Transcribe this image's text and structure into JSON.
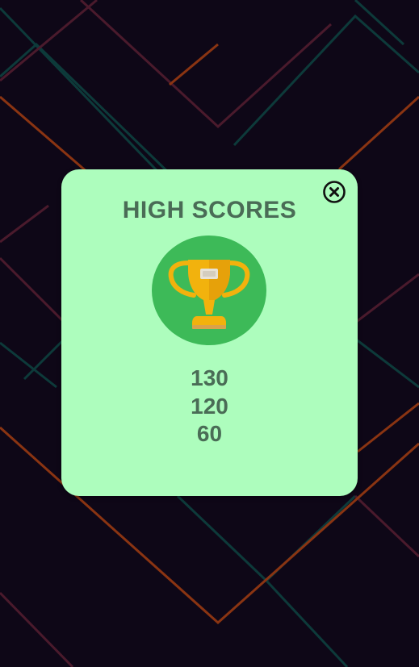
{
  "dialog": {
    "title": "HIGH SCORES",
    "close_icon": "close-circle-icon",
    "trophy_icon": "trophy-icon",
    "scores": [
      "130",
      "120",
      "60"
    ]
  },
  "colors": {
    "background": "#0e0717",
    "dialog_background": "#adfdbd",
    "text": "#4a6c56",
    "trophy_circle": "#3dba58",
    "trophy_gold": "#f2b20d",
    "line_orange": "#8a3412",
    "line_teal": "#0d3a3a",
    "line_maroon": "#4a1a2c"
  }
}
